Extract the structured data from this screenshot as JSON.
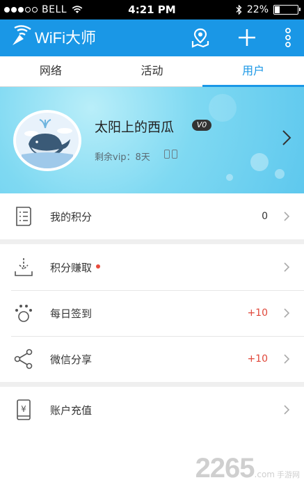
{
  "status_bar": {
    "carrier": "BELL",
    "time": "4:21 PM",
    "battery": "22%",
    "battery_level": 0.22
  },
  "app_bar": {
    "title": "WiFi大师",
    "icons": [
      "map-pin-icon",
      "plus-icon",
      "more-icon"
    ]
  },
  "tabs": [
    {
      "label": "网络",
      "active": false
    },
    {
      "label": "活动",
      "active": false
    },
    {
      "label": "用户",
      "active": true
    }
  ],
  "profile": {
    "username": "太阳上的西瓜",
    "vip_level": "V0",
    "vip_remaining": "剩余vip：8天"
  },
  "points_section": {
    "label": "我的积分",
    "value": "0"
  },
  "earn_section": {
    "items": [
      {
        "label": "积分赚取",
        "value": "",
        "new_dot": true
      },
      {
        "label": "每日签到",
        "value": "+10"
      },
      {
        "label": "微信分享",
        "value": "+10"
      }
    ]
  },
  "recharge_section": {
    "label": "账户充值",
    "currency_symbol": "¥"
  },
  "watermark": {
    "number": "2265",
    "suffix": ".com",
    "tag": "手游网"
  },
  "colors": {
    "primary": "#1a97e6",
    "accent_red": "#e0473a",
    "banner": "#7fd9f2"
  }
}
